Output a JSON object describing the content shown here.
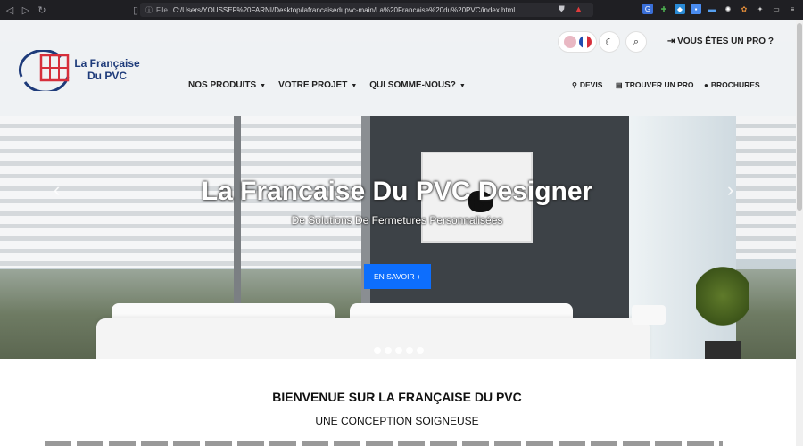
{
  "browser": {
    "file_label": "File",
    "url": "C:/Users/YOUSSEF%20FARNI/Desktop/lafrancaisedupvc-main/La%20Francaise%20du%20PVC/index.html",
    "nav_icons": [
      "back-icon",
      "forward-icon",
      "reload-icon",
      "bookmark-icon"
    ]
  },
  "header": {
    "logo_line1": "La Française",
    "logo_line2": "Du PVC",
    "pro_link": "VOUS ÊTES UN PRO ?",
    "menu": [
      {
        "label": "NOS PRODUITS"
      },
      {
        "label": "VOTRE PROJET"
      },
      {
        "label": "QUI SOMME-NOUS?"
      }
    ],
    "utility": [
      {
        "label": "DEVIS",
        "icon": "pin-icon"
      },
      {
        "label": "TROUVER UN PRO",
        "icon": "document-icon"
      },
      {
        "label": "BROCHURES",
        "icon": "chat-icon"
      }
    ]
  },
  "hero": {
    "title": "La Francaise Du PVC Designer",
    "subtitle": "De Solutions De Fermetures Personnalisées",
    "cta": "EN SAVOIR +",
    "slide_count": 5,
    "active_slide": 1
  },
  "main": {
    "welcome": "BIENVENUE SUR LA FRANÇAISE DU PVC",
    "subheading": "UNE CONCEPTION SOIGNEUSE"
  },
  "colors": {
    "brand_blue": "#1e3b7a",
    "brand_red": "#d62f3b",
    "cta_blue": "#0d6efd"
  }
}
